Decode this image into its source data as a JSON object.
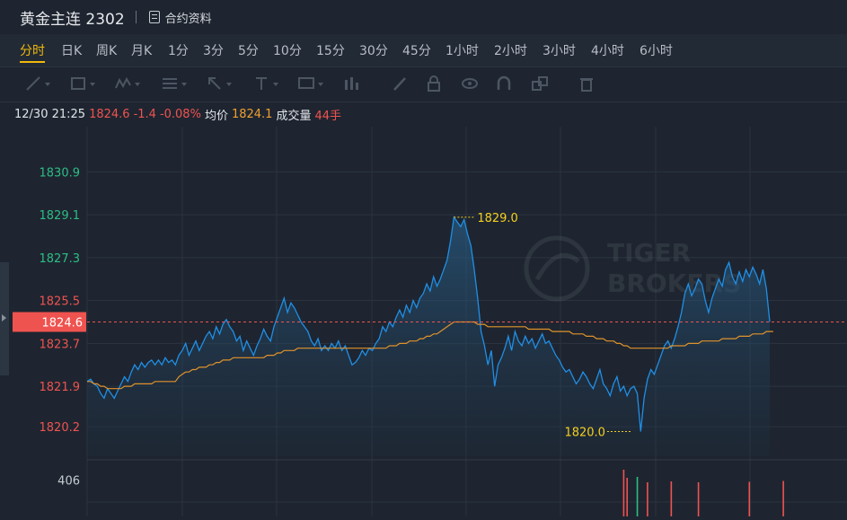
{
  "header": {
    "title": "黄金主连 2302",
    "contract_label": "合约资料"
  },
  "tabs": [
    "分时",
    "日K",
    "周K",
    "月K",
    "1分",
    "3分",
    "5分",
    "10分",
    "15分",
    "30分",
    "45分",
    "1小时",
    "2小时",
    "3小时",
    "4小时",
    "6小时"
  ],
  "active_tab": "分时",
  "info": {
    "time": "12/30 21:25",
    "price": "1824.6",
    "change": "-1.4",
    "change_pct": "-0.08%",
    "avg_label": "均价",
    "avg_value": "1824.1",
    "volume_label": "成交量",
    "volume_value": "44手"
  },
  "current_price_label": "1824.6",
  "watermark": {
    "line1": "TIGER",
    "line2": "BROKERS"
  },
  "colors": {
    "up": "#2ebd85",
    "down": "#ef5350",
    "price_line": "#1f8fe6",
    "avg_line": "#e0932b",
    "accent": "#f0b90b",
    "annotation": "#f5d020"
  },
  "tools": [
    "line-tool-icon",
    "rectangle-tool-icon",
    "wave-tool-icon",
    "fibonacci-tool-icon",
    "arrow-tool-icon",
    "text-tool-icon",
    "note-tool-icon",
    "bar-tool-icon",
    "brush-icon",
    "lock-icon",
    "eye-icon",
    "magnet-icon",
    "layers-icon",
    "trash-icon"
  ],
  "chart_data": {
    "type": "line",
    "y_ticks": [
      {
        "value": 1830.9,
        "color": "#2ebd85"
      },
      {
        "value": 1829.1,
        "color": "#2ebd85"
      },
      {
        "value": 1827.3,
        "color": "#2ebd85"
      },
      {
        "value": 1825.5,
        "color": "#ef5350"
      },
      {
        "value": 1823.7,
        "color": "#ef5350"
      },
      {
        "value": 1821.9,
        "color": "#ef5350"
      },
      {
        "value": 1820.2,
        "color": "#ef5350"
      }
    ],
    "ylim": [
      1819.0,
      1832.5
    ],
    "reference": 1824.6,
    "annotations": [
      {
        "label": "1829.0",
        "value": 1829.0,
        "index": 108
      },
      {
        "label": "1820.0",
        "value": 1820.0,
        "index": 160
      }
    ],
    "price": [
      1822.1,
      1822.2,
      1822.0,
      1821.9,
      1821.6,
      1821.4,
      1821.8,
      1821.6,
      1821.4,
      1821.7,
      1822.0,
      1822.3,
      1822.1,
      1822.5,
      1822.8,
      1822.6,
      1822.9,
      1822.7,
      1822.9,
      1823.0,
      1822.8,
      1823.0,
      1822.8,
      1823.1,
      1822.9,
      1823.0,
      1822.8,
      1823.2,
      1823.4,
      1823.7,
      1823.2,
      1823.5,
      1823.8,
      1823.4,
      1823.7,
      1824.0,
      1824.2,
      1823.9,
      1824.4,
      1824.1,
      1824.5,
      1824.7,
      1824.4,
      1824.2,
      1823.8,
      1824.0,
      1823.4,
      1823.8,
      1823.5,
      1823.2,
      1823.6,
      1823.9,
      1824.3,
      1824.0,
      1823.8,
      1824.4,
      1824.8,
      1825.2,
      1825.6,
      1825.0,
      1825.4,
      1825.2,
      1824.9,
      1824.6,
      1824.4,
      1824.2,
      1823.8,
      1823.6,
      1823.9,
      1823.4,
      1823.6,
      1823.4,
      1823.7,
      1823.5,
      1823.8,
      1823.4,
      1823.6,
      1823.2,
      1822.8,
      1822.9,
      1823.1,
      1823.4,
      1823.2,
      1823.5,
      1823.4,
      1823.7,
      1823.9,
      1824.4,
      1824.2,
      1824.6,
      1824.4,
      1824.8,
      1825.1,
      1824.8,
      1825.3,
      1825.0,
      1825.5,
      1825.2,
      1825.6,
      1825.8,
      1826.2,
      1825.9,
      1826.5,
      1826.1,
      1826.4,
      1826.8,
      1827.2,
      1828.0,
      1829.0,
      1828.8,
      1828.6,
      1828.9,
      1828.3,
      1827.8,
      1826.8,
      1825.6,
      1824.2,
      1823.6,
      1822.8,
      1823.4,
      1821.9,
      1822.8,
      1823.1,
      1823.5,
      1824.0,
      1823.4,
      1824.2,
      1823.8,
      1823.6,
      1824.0,
      1823.7,
      1823.9,
      1823.5,
      1823.8,
      1824.1,
      1823.7,
      1823.8,
      1823.5,
      1823.2,
      1823.0,
      1822.7,
      1822.5,
      1822.6,
      1822.3,
      1822.0,
      1822.2,
      1822.5,
      1822.3,
      1822.0,
      1821.8,
      1822.2,
      1822.6,
      1822.0,
      1821.8,
      1821.5,
      1822.0,
      1822.3,
      1821.7,
      1821.9,
      1821.5,
      1821.8,
      1821.9,
      1821.6,
      1820.0,
      1821.4,
      1822.2,
      1822.6,
      1822.4,
      1822.8,
      1823.2,
      1823.6,
      1823.8,
      1823.5,
      1823.9,
      1824.4,
      1825.0,
      1825.8,
      1826.2,
      1825.7,
      1826.0,
      1826.4,
      1826.2,
      1825.5,
      1825.0,
      1825.6,
      1826.0,
      1826.4,
      1826.1,
      1826.8,
      1827.1,
      1826.5,
      1826.2,
      1826.7,
      1826.3,
      1826.8,
      1826.5,
      1826.9,
      1826.6,
      1826.2,
      1826.8,
      1826.0,
      1824.6
    ],
    "avg": [
      1822.1,
      1822.1,
      1822.0,
      1822.0,
      1821.9,
      1821.9,
      1821.8,
      1821.8,
      1821.8,
      1821.8,
      1821.8,
      1821.9,
      1821.9,
      1821.9,
      1822.0,
      1822.0,
      1822.0,
      1822.0,
      1822.0,
      1822.0,
      1822.1,
      1822.1,
      1822.1,
      1822.1,
      1822.1,
      1822.1,
      1822.1,
      1822.3,
      1822.4,
      1822.5,
      1822.5,
      1822.6,
      1822.6,
      1822.7,
      1822.7,
      1822.7,
      1822.8,
      1822.8,
      1822.9,
      1822.9,
      1823.0,
      1823.0,
      1823.0,
      1823.1,
      1823.1,
      1823.1,
      1823.1,
      1823.1,
      1823.1,
      1823.1,
      1823.1,
      1823.1,
      1823.1,
      1823.2,
      1823.2,
      1823.2,
      1823.3,
      1823.3,
      1823.4,
      1823.4,
      1823.4,
      1823.4,
      1823.5,
      1823.5,
      1823.5,
      1823.5,
      1823.5,
      1823.5,
      1823.5,
      1823.5,
      1823.5,
      1823.5,
      1823.5,
      1823.5,
      1823.5,
      1823.5,
      1823.5,
      1823.5,
      1823.5,
      1823.5,
      1823.5,
      1823.5,
      1823.5,
      1823.5,
      1823.5,
      1823.5,
      1823.5,
      1823.5,
      1823.5,
      1823.6,
      1823.6,
      1823.6,
      1823.7,
      1823.7,
      1823.7,
      1823.8,
      1823.8,
      1823.8,
      1823.9,
      1823.9,
      1824.0,
      1824.0,
      1824.1,
      1824.1,
      1824.2,
      1824.3,
      1824.4,
      1824.5,
      1824.6,
      1824.6,
      1824.6,
      1824.6,
      1824.6,
      1824.6,
      1824.6,
      1824.5,
      1824.5,
      1824.5,
      1824.4,
      1824.4,
      1824.4,
      1824.4,
      1824.4,
      1824.4,
      1824.4,
      1824.4,
      1824.4,
      1824.4,
      1824.4,
      1824.4,
      1824.3,
      1824.3,
      1824.3,
      1824.3,
      1824.3,
      1824.3,
      1824.3,
      1824.2,
      1824.2,
      1824.2,
      1824.2,
      1824.2,
      1824.2,
      1824.1,
      1824.1,
      1824.1,
      1824.1,
      1824.0,
      1824.0,
      1824.0,
      1823.9,
      1823.9,
      1823.9,
      1823.8,
      1823.8,
      1823.8,
      1823.7,
      1823.7,
      1823.6,
      1823.6,
      1823.5,
      1823.5,
      1823.5,
      1823.5,
      1823.5,
      1823.5,
      1823.5,
      1823.5,
      1823.5,
      1823.5,
      1823.5,
      1823.5,
      1823.6,
      1823.6,
      1823.6,
      1823.6,
      1823.6,
      1823.7,
      1823.7,
      1823.7,
      1823.7,
      1823.8,
      1823.8,
      1823.8,
      1823.8,
      1823.8,
      1823.8,
      1823.9,
      1823.9,
      1823.9,
      1823.9,
      1823.9,
      1824.0,
      1824.0,
      1824.0,
      1824.0,
      1824.1,
      1824.1,
      1824.1,
      1824.1,
      1824.2,
      1824.2,
      1824.2
    ],
    "volume_tick": 406,
    "volume": [
      {
        "index": 158,
        "value": 520,
        "color": "#ef5350"
      },
      {
        "index": 159,
        "value": 430,
        "color": "#ef5350"
      },
      {
        "index": 162,
        "value": 440,
        "color": "#2ebd85"
      },
      {
        "index": 165,
        "value": 380,
        "color": "#ef5350"
      },
      {
        "index": 172,
        "value": 390,
        "color": "#ef5350"
      },
      {
        "index": 180,
        "value": 380,
        "color": "#ef5350"
      },
      {
        "index": 195,
        "value": 385,
        "color": "#ef5350"
      },
      {
        "index": 205,
        "value": 395,
        "color": "#ef5350"
      }
    ]
  }
}
